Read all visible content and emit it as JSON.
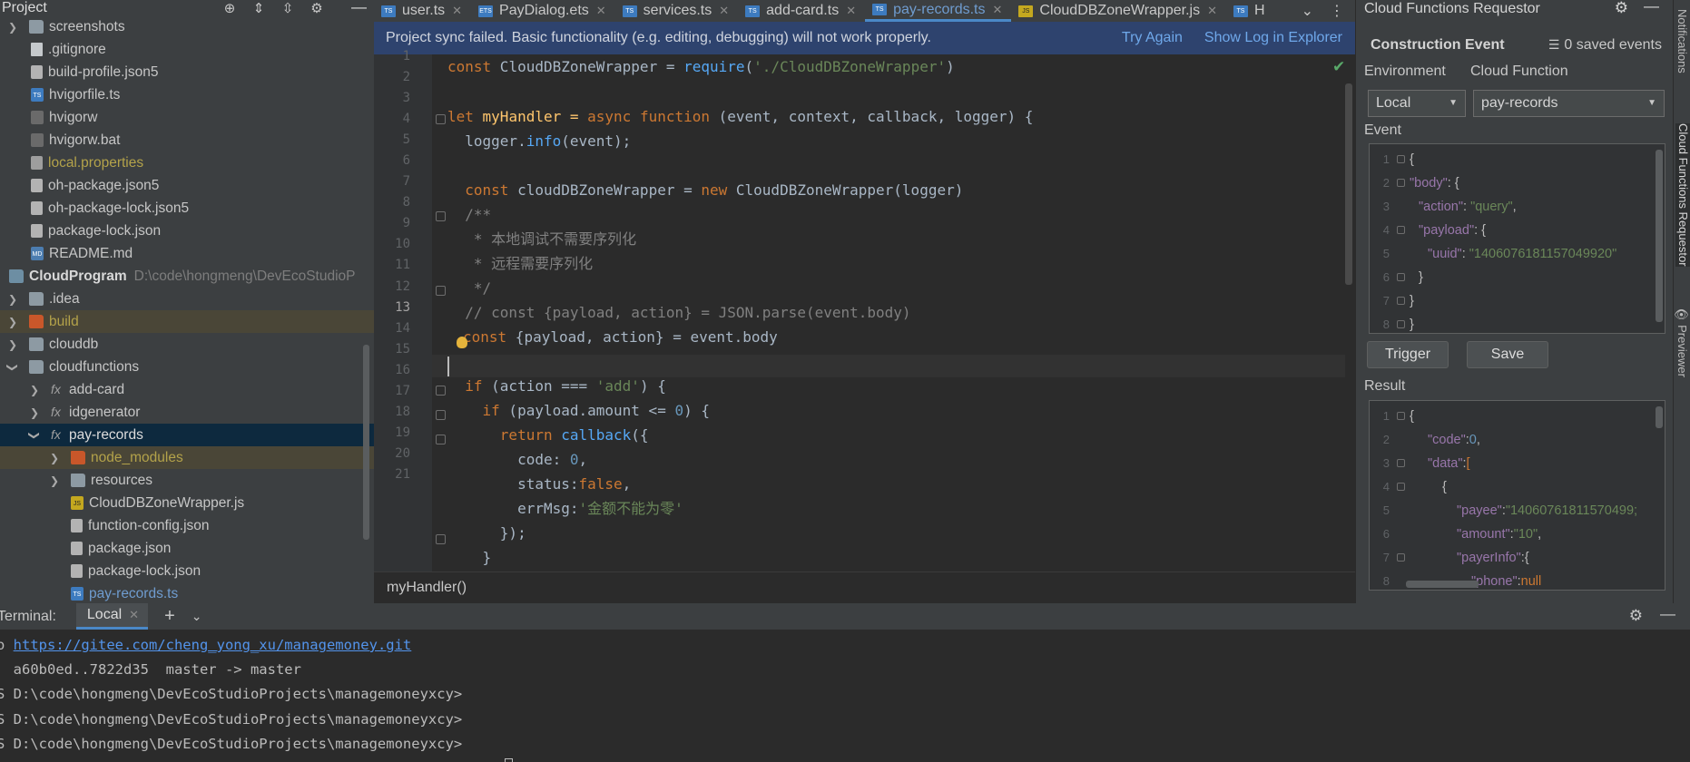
{
  "project_panel": {
    "title": "Project",
    "items": [
      {
        "label": "screenshots",
        "type": "dir"
      },
      {
        "label": ".gitignore",
        "type": "file"
      },
      {
        "label": "build-profile.json5",
        "type": "json"
      },
      {
        "label": "hvigorfile.ts",
        "type": "ts"
      },
      {
        "label": "hvigorw",
        "type": "sh"
      },
      {
        "label": "hvigorw.bat",
        "type": "sh"
      },
      {
        "label": "local.properties",
        "type": "prop"
      },
      {
        "label": "oh-package.json5",
        "type": "json"
      },
      {
        "label": "oh-package-lock.json5",
        "type": "json"
      },
      {
        "label": "package-lock.json",
        "type": "json"
      },
      {
        "label": "README.md",
        "type": "md"
      },
      {
        "label": "CloudProgram",
        "path": "D:\\code\\hongmeng\\DevEcoStudioP",
        "type": "module"
      },
      {
        "label": ".idea",
        "type": "dir"
      },
      {
        "label": "build",
        "type": "dir"
      },
      {
        "label": "clouddb",
        "type": "dir"
      },
      {
        "label": "cloudfunctions",
        "type": "dir"
      },
      {
        "label": "add-card",
        "type": "fx"
      },
      {
        "label": "idgenerator",
        "type": "fx"
      },
      {
        "label": "pay-records",
        "type": "fx"
      },
      {
        "label": "node_modules",
        "type": "dir"
      },
      {
        "label": "resources",
        "type": "dir"
      },
      {
        "label": "CloudDBZoneWrapper.js",
        "type": "js"
      },
      {
        "label": "function-config.json",
        "type": "json"
      },
      {
        "label": "package.json",
        "type": "json"
      },
      {
        "label": "package-lock.json",
        "type": "json"
      },
      {
        "label": "pay-records.ts",
        "type": "ts"
      }
    ]
  },
  "editor": {
    "tabs": [
      {
        "label": "user.ts",
        "icon": "ts"
      },
      {
        "label": "PayDialog.ets",
        "icon": "ets"
      },
      {
        "label": "services.ts",
        "icon": "ts"
      },
      {
        "label": "add-card.ts",
        "icon": "ts"
      },
      {
        "label": "pay-records.ts",
        "icon": "ts",
        "active": true
      },
      {
        "label": "CloudDBZoneWrapper.js",
        "icon": "js"
      },
      {
        "label": "H",
        "icon": "ts"
      }
    ],
    "banner": {
      "message": "Project sync failed. Basic functionality (e.g. editing, debugging) will not work properly.",
      "try_again": "Try Again",
      "show_log": "Show Log in Explorer"
    },
    "line_numbers": [
      "1",
      "2",
      "3",
      "4",
      "5",
      "6",
      "7",
      "8",
      "9",
      "10",
      "11",
      "12",
      "13",
      "14",
      "15",
      "16",
      "17",
      "18",
      "19",
      "20",
      "21"
    ],
    "code": {
      "l1_kw": "const",
      "l1_id": " CloudDBZoneWrapper = ",
      "l1_fn": "require",
      "l1_str": "'./CloudDBZoneWrapper'",
      "l3_kw": "let",
      "l3_id": " myHandler = ",
      "l3_kw2": "async function",
      "l3_params": " (event, context, callback, logger) {",
      "l4_a": "  logger.",
      "l4_fn": "info",
      "l4_b": "(event);",
      "l6_kw": "  const",
      "l6_a": " cloudDBZoneWrapper = ",
      "l6_kw2": "new",
      "l6_b": " CloudDBZoneWrapper(logger)",
      "l7": "  /**",
      "l8": "   * 本地调试不需要序列化",
      "l9": "   * 远程需要序列化",
      "l10": "   */",
      "l11": "  // const {payload, action} = JSON.parse(event.body)",
      "l12_kw": "const",
      "l12_b": " {payload, action} = event.body",
      "l14_kw": "  if",
      "l14_a": " (action === ",
      "l14_str": "'add'",
      "l14_b": ") {",
      "l15_kw": "    if",
      "l15_a": " (payload.amount <= ",
      "l15_num": "0",
      "l15_b": ") {",
      "l16_kw": "      return",
      "l16_fn": " callback",
      "l16_b": "({",
      "l17_a": "        code: ",
      "l17_num": "0",
      "l17_b": ",",
      "l18_a": "        status:",
      "l18_kw": "false",
      "l18_b": ",",
      "l19_a": "        errMsg:",
      "l19_str": "'金额不能为零'",
      "l20": "      });",
      "l21": "    }"
    },
    "breadcrumb": "myHandler()"
  },
  "cloud_panel": {
    "title": "Cloud Functions Requestor",
    "section_title": "Construction Event",
    "saved_events": "0 saved events",
    "environment_label": "Environment",
    "function_label": "Cloud Function",
    "environment_value": "Local",
    "function_value": "pay-records",
    "event_label": "Event",
    "event_json": {
      "n": [
        "1",
        "2",
        "3",
        "4",
        "5",
        "6",
        "7",
        "8"
      ],
      "l1": "{",
      "l2k": "\"body\"",
      "l2b": ": {",
      "l3k": "\"action\"",
      "l3v": "\"query\"",
      "l4k": "\"payload\"",
      "l4b": ": {",
      "l5k": "\"uuid\"",
      "l5v": "\"1406076181157049920\"",
      "l6": "}",
      "l7": "}",
      "l8": "}"
    },
    "trigger_label": "Trigger",
    "save_label": "Save",
    "result_label": "Result",
    "result_json": {
      "n": [
        "1",
        "2",
        "3",
        "4",
        "5",
        "6",
        "7",
        "8"
      ],
      "l1": "{",
      "l2k": "\"code\"",
      "l2v": "0",
      "l3k": "\"data\"",
      "l3b": "[",
      "l4": "{",
      "l5k": "\"payee\"",
      "l5v": "\"14060761811570499;",
      "l6k": "\"amount\"",
      "l6v": "\"10\"",
      "l7k": "\"payerInfo\"",
      "l7b": ":{",
      "l8k": "\"phone\"",
      "l8v": "null"
    }
  },
  "side_toolbar": {
    "notifications": "Notifications",
    "requestor": "Cloud Functions Requestor",
    "previewer": "Previewer"
  },
  "terminal": {
    "label": "Terminal:",
    "tab": "Local",
    "lines": [
      {
        "prefix": "o ",
        "link": "https://gitee.com/cheng_yong_xu/managemoney.git"
      },
      {
        "text": "  a60b0ed..7822d35  master -> master"
      },
      {
        "text": "S D:\\code\\hongmeng\\DevEcoStudioProjects\\managemoneyxcy>"
      },
      {
        "text": "S D:\\code\\hongmeng\\DevEcoStudioProjects\\managemoneyxcy>"
      },
      {
        "text": "S D:\\code\\hongmeng\\DevEcoStudioProjects\\managemoneyxcy>"
      }
    ]
  },
  "colors": {
    "banner_bg": "#2e436e",
    "selection": "#0d293e",
    "link": "#6fa8ea",
    "keyword": "#cc7832",
    "string": "#6a8759"
  }
}
